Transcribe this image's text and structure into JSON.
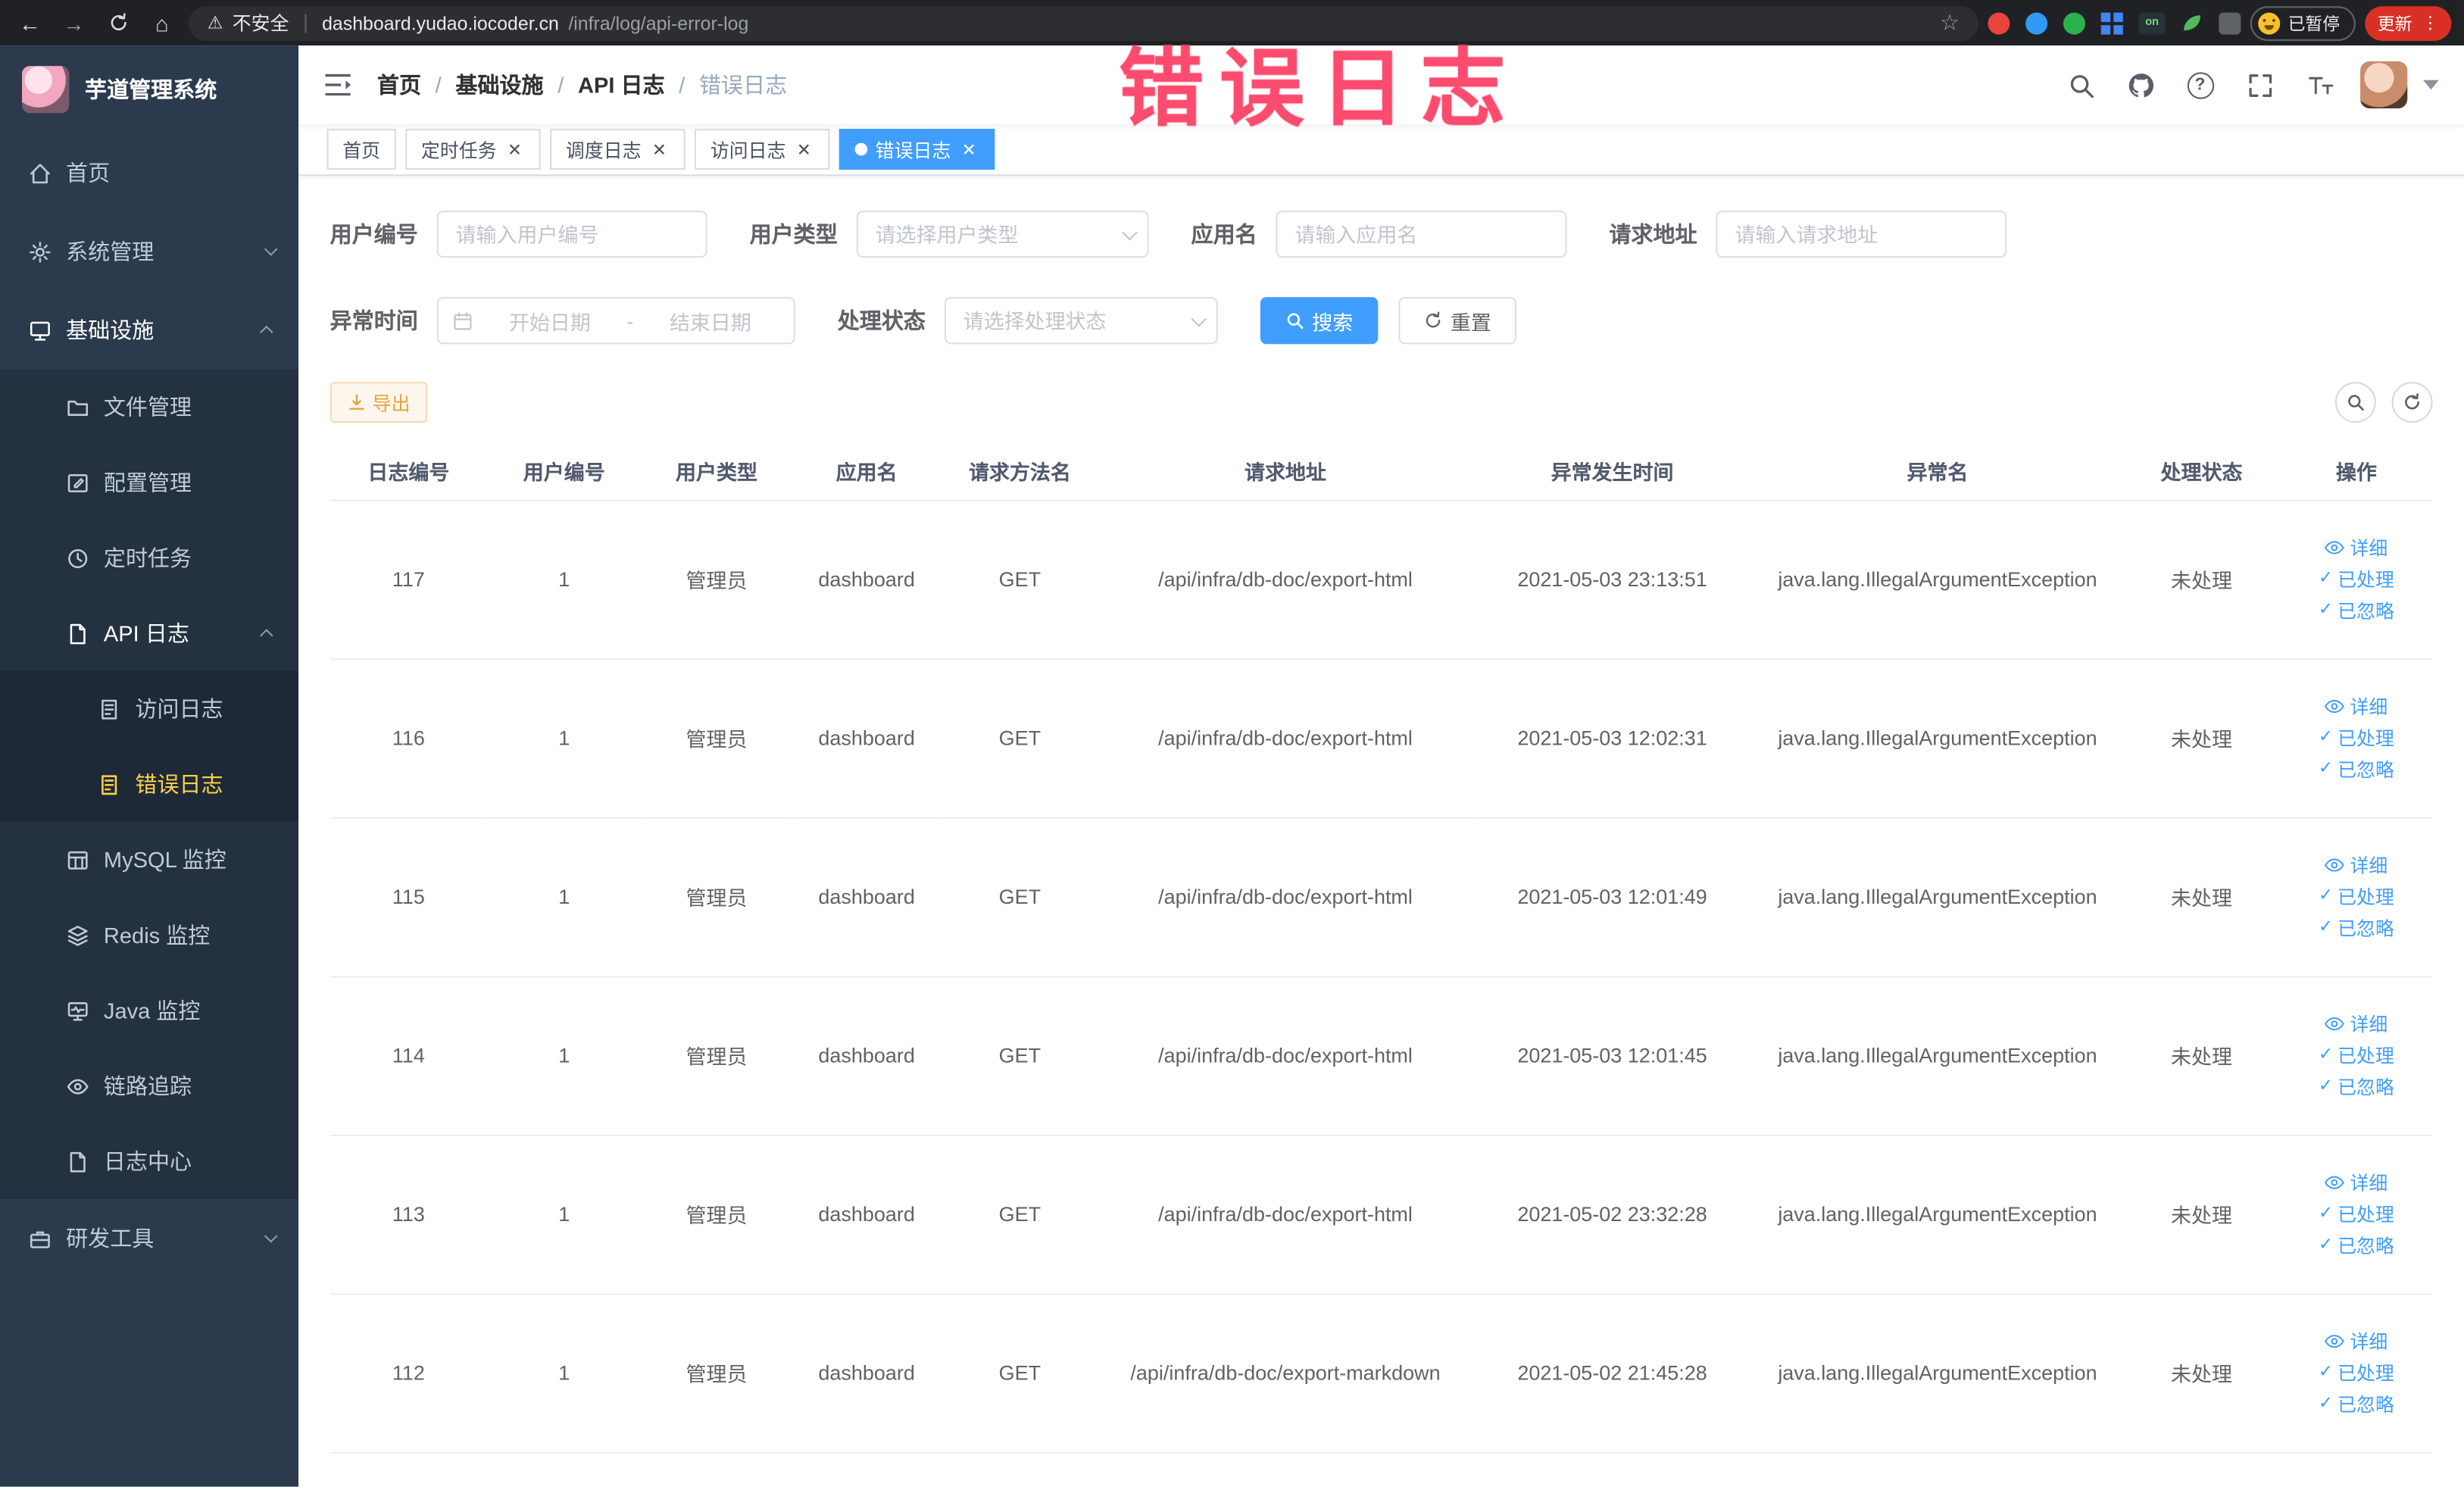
{
  "colors": {
    "primary": "#409EFF",
    "sidebar_bg": "#2b3a4d",
    "menu_active_text": "#ffd04b",
    "export_warning": "#e6a23c",
    "annotation_pink": "#fb4b6e",
    "update_button": "#d93025"
  },
  "browser": {
    "security_label": "不安全",
    "url_host": "dashboard.yudao.iocoder.cn",
    "url_path": "/infra/log/api-error-log",
    "on_badge": "on",
    "paused_label": "已暂停",
    "update_label": "更新"
  },
  "annotation": {
    "text": "错误日志"
  },
  "sidebar": {
    "logo_title": "芋道管理系统",
    "items": {
      "home": "首页",
      "system": "系统管理",
      "infra": "基础设施",
      "file": "文件管理",
      "config": "配置管理",
      "job": "定时任务",
      "api_log": "API 日志",
      "access_log": "访问日志",
      "error_log": "错误日志",
      "mysql": "MySQL 监控",
      "redis": "Redis 监控",
      "java": "Java 监控",
      "trace": "链路追踪",
      "log_center": "日志中心",
      "dev_tools": "研发工具"
    }
  },
  "breadcrumb": [
    "首页",
    "基础设施",
    "API 日志",
    "错误日志"
  ],
  "tabs": [
    {
      "label": "首页"
    },
    {
      "label": "定时任务"
    },
    {
      "label": "调度日志"
    },
    {
      "label": "访问日志"
    },
    {
      "label": "错误日志"
    }
  ],
  "filters": {
    "user_id_label": "用户编号",
    "user_id_placeholder": "请输入用户编号",
    "user_type_label": "用户类型",
    "user_type_placeholder": "请选择用户类型",
    "app_name_label": "应用名",
    "app_name_placeholder": "请输入应用名",
    "request_url_label": "请求地址",
    "request_url_placeholder": "请输入请求地址",
    "exception_time_label": "异常时间",
    "range_start_placeholder": "开始日期",
    "range_separator": "-",
    "range_end_placeholder": "结束日期",
    "process_status_label": "处理状态",
    "process_status_placeholder": "请选择处理状态",
    "search_label": "搜索",
    "reset_label": "重置"
  },
  "toolbar": {
    "export_label": "导出"
  },
  "table": {
    "columns": [
      "日志编号",
      "用户编号",
      "用户类型",
      "应用名",
      "请求方法名",
      "请求地址",
      "异常发生时间",
      "异常名",
      "处理状态",
      "操作"
    ],
    "actions": [
      "详细",
      "已处理",
      "已忽略"
    ],
    "rows": [
      {
        "id": "117",
        "user_id": "1",
        "user_type": "管理员",
        "app": "dashboard",
        "method": "GET",
        "url": "/api/infra/db-doc/export-html",
        "time": "2021-05-03 23:13:51",
        "exception": "java.lang.IllegalArgumentException",
        "status": "未处理"
      },
      {
        "id": "116",
        "user_id": "1",
        "user_type": "管理员",
        "app": "dashboard",
        "method": "GET",
        "url": "/api/infra/db-doc/export-html",
        "time": "2021-05-03 12:02:31",
        "exception": "java.lang.IllegalArgumentException",
        "status": "未处理"
      },
      {
        "id": "115",
        "user_id": "1",
        "user_type": "管理员",
        "app": "dashboard",
        "method": "GET",
        "url": "/api/infra/db-doc/export-html",
        "time": "2021-05-03 12:01:49",
        "exception": "java.lang.IllegalArgumentException",
        "status": "未处理"
      },
      {
        "id": "114",
        "user_id": "1",
        "user_type": "管理员",
        "app": "dashboard",
        "method": "GET",
        "url": "/api/infra/db-doc/export-html",
        "time": "2021-05-03 12:01:45",
        "exception": "java.lang.IllegalArgumentException",
        "status": "未处理"
      },
      {
        "id": "113",
        "user_id": "1",
        "user_type": "管理员",
        "app": "dashboard",
        "method": "GET",
        "url": "/api/infra/db-doc/export-html",
        "time": "2021-05-02 23:32:28",
        "exception": "java.lang.IllegalArgumentException",
        "status": "未处理"
      },
      {
        "id": "112",
        "user_id": "1",
        "user_type": "管理员",
        "app": "dashboard",
        "method": "GET",
        "url": "/api/infra/db-doc/export-markdown",
        "time": "2021-05-02 21:45:28",
        "exception": "java.lang.IllegalArgumentException",
        "status": "未处理"
      }
    ]
  }
}
